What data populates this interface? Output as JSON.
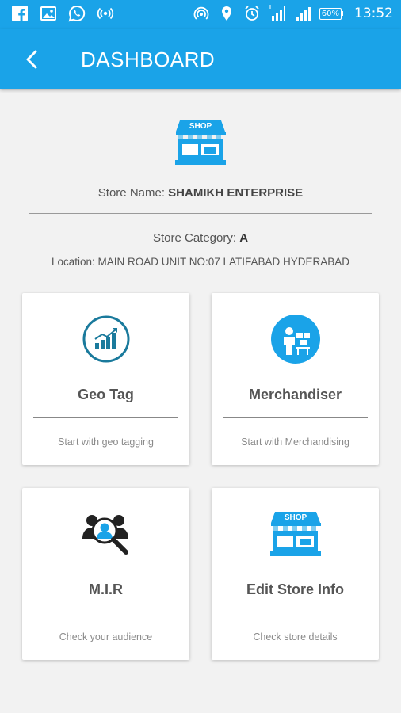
{
  "status_bar": {
    "time": "13:52",
    "battery": "60%",
    "left_icons": [
      "facebook-icon",
      "gallery-icon",
      "whatsapp-icon",
      "broadcast-icon"
    ],
    "right_icons": [
      "hotspot-icon",
      "location-icon",
      "alarm-icon",
      "signal-4g-icon",
      "signal-icon",
      "battery-icon"
    ]
  },
  "header": {
    "title": "DASHBOARD"
  },
  "store": {
    "name_label": "Store Name: ",
    "name_value": "SHAMIKH ENTERPRISE",
    "category_label": "Store Category: ",
    "category_value": "A",
    "location": "Location: MAIN ROAD UNIT NO:07 LATIFABAD HYDERABAD",
    "shop_sign": "SHOP"
  },
  "cards": [
    {
      "title": "Geo Tag",
      "subtitle": "Start with geo tagging",
      "icon": "chart-growth-icon"
    },
    {
      "title": "Merchandiser",
      "subtitle": "Start with Merchandising",
      "icon": "merchandiser-icon"
    },
    {
      "title": "M.I.R",
      "subtitle": "Check your audience",
      "icon": "audience-search-icon"
    },
    {
      "title": "Edit Store Info",
      "subtitle": "Check store details",
      "icon": "shop-icon",
      "shop_sign": "SHOP"
    }
  ],
  "colors": {
    "primary": "#1aa3e8",
    "icon_dark": "#1a7a9c",
    "background": "#f2f2f2"
  }
}
